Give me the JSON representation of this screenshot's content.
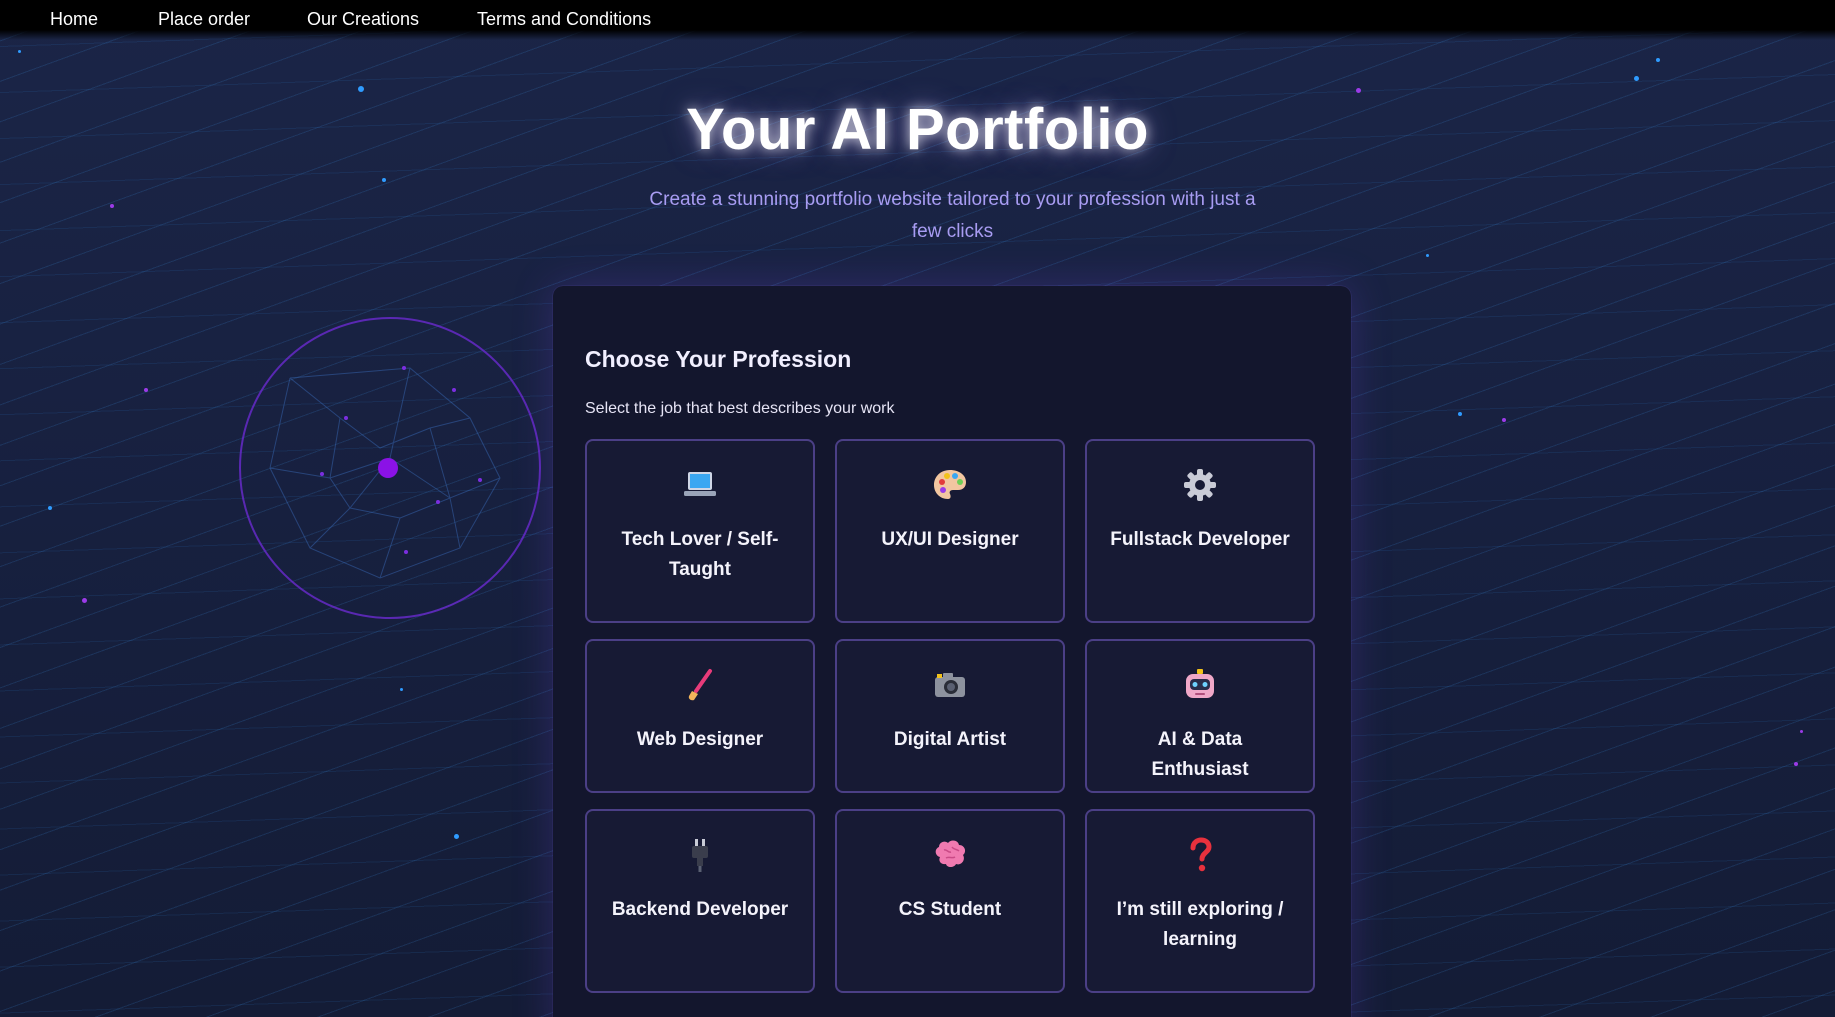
{
  "nav": {
    "links": [
      "Home",
      "Place order",
      "Our Creations",
      "Terms and Conditions"
    ]
  },
  "hero": {
    "title": "Your AI Portfolio",
    "subtitle": "Create a stunning portfolio website tailored to your profession with just a few clicks"
  },
  "profession": {
    "title": "Choose Your Profession",
    "subtitle": "Select the job that best describes your work",
    "options": [
      {
        "label": "Tech Lover / Self-Taught",
        "icon": "laptop-icon"
      },
      {
        "label": "UX/UI Designer",
        "icon": "palette-icon"
      },
      {
        "label": "Fullstack Developer",
        "icon": "gear-icon"
      },
      {
        "label": "Web Designer",
        "icon": "paintbrush-icon"
      },
      {
        "label": "Digital Artist",
        "icon": "camera-icon"
      },
      {
        "label": "AI & Data Enthusiast",
        "icon": "robot-icon"
      },
      {
        "label": "Backend Developer",
        "icon": "plug-icon"
      },
      {
        "label": "CS Student",
        "icon": "brain-icon"
      },
      {
        "label": "I’m still exploring / learning",
        "icon": "question-mark-icon"
      }
    ]
  },
  "colors": {
    "accent": "#8b2be2",
    "card_border": "#4b3f86",
    "subtitle": "#a89cf2"
  }
}
